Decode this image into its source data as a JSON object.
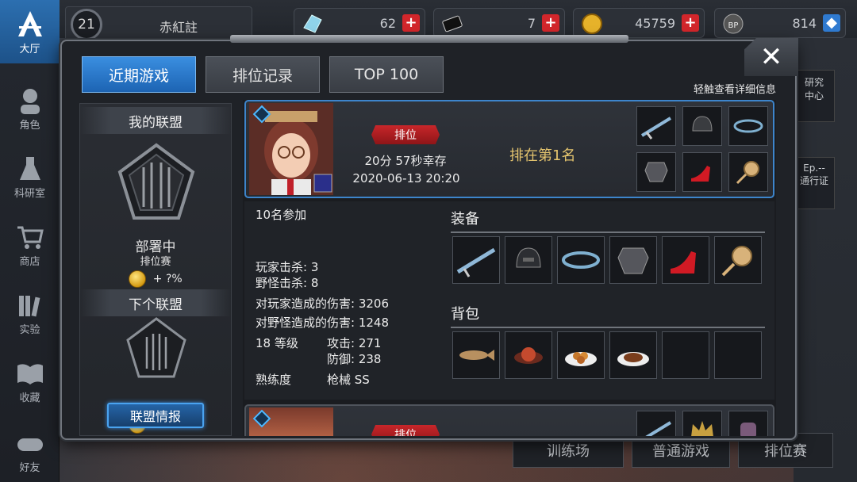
{
  "app": {
    "player": {
      "level": "21",
      "name": "赤紅註"
    },
    "resources": [
      {
        "icon": "crystal-icon",
        "value": "62"
      },
      {
        "icon": "card-icon",
        "value": "7"
      },
      {
        "icon": "gold-coin-icon",
        "value": "45759"
      },
      {
        "icon": "bp-paw-icon",
        "value": "814"
      }
    ],
    "left_nav": [
      {
        "label": "大厅",
        "icon": "lobby-icon",
        "active": true
      },
      {
        "label": "角色",
        "icon": "character-icon"
      },
      {
        "label": "科研室",
        "icon": "lab-flask-icon"
      },
      {
        "label": "商店",
        "icon": "shop-cart-icon"
      },
      {
        "label": "实验",
        "icon": "books-icon"
      },
      {
        "label": "收藏",
        "icon": "open-book-icon"
      },
      {
        "label": "好友",
        "icon": "gamepad-icon"
      }
    ],
    "right_side": [
      "研究\n中心",
      "Ep.--\n通行证"
    ],
    "bottom_modes": [
      "训练场",
      "普通游戏",
      "排位赛"
    ]
  },
  "modal": {
    "tabs": [
      "近期游戏",
      "排位记录",
      "TOP 100"
    ],
    "hint": "轻触查看详细信息",
    "alliance": {
      "my_title": "我的联盟",
      "status": "部署中",
      "league": "排位赛",
      "coin_bonus": "+ ?%",
      "next_title": "下个联盟",
      "next_coin_bonus": "+ ?%",
      "info_button": "联盟情报"
    },
    "game": {
      "mode": "排位",
      "survival": "20分 57秒幸存",
      "datetime": "2020-06-13 20:20",
      "rank": "排在第1名",
      "participants": "10名参加",
      "player_kills": "玩家击杀: 3",
      "monster_kills": "野怪击杀: 8",
      "player_damage": "对玩家造成的伤害: 3206",
      "monster_damage": "对野怪造成的伤害: 1248",
      "level": "18 等级",
      "attack": "攻击: 271",
      "defense": "防御: 238",
      "proficiency_label": "熟练度",
      "proficiency_value": "枪械 SS",
      "equipment_title": "装备",
      "backpack_title": "背包",
      "equipment": [
        "rifle-icon",
        "helmet-icon",
        "chain-belt-icon",
        "armor-icon",
        "red-heel-shoe-icon",
        "magnifier-accessory-icon"
      ],
      "backpack": [
        "fish-icon",
        "meat-dish-icon",
        "food-plate-icon",
        "stew-plate-icon",
        "empty",
        "empty"
      ]
    },
    "second_game_mode": "排位"
  },
  "colors": {
    "accent_blue": "#2e84d8",
    "rank_gold": "#e4c46e",
    "tag_red": "#c8262a",
    "plus_red": "#d2262b"
  }
}
